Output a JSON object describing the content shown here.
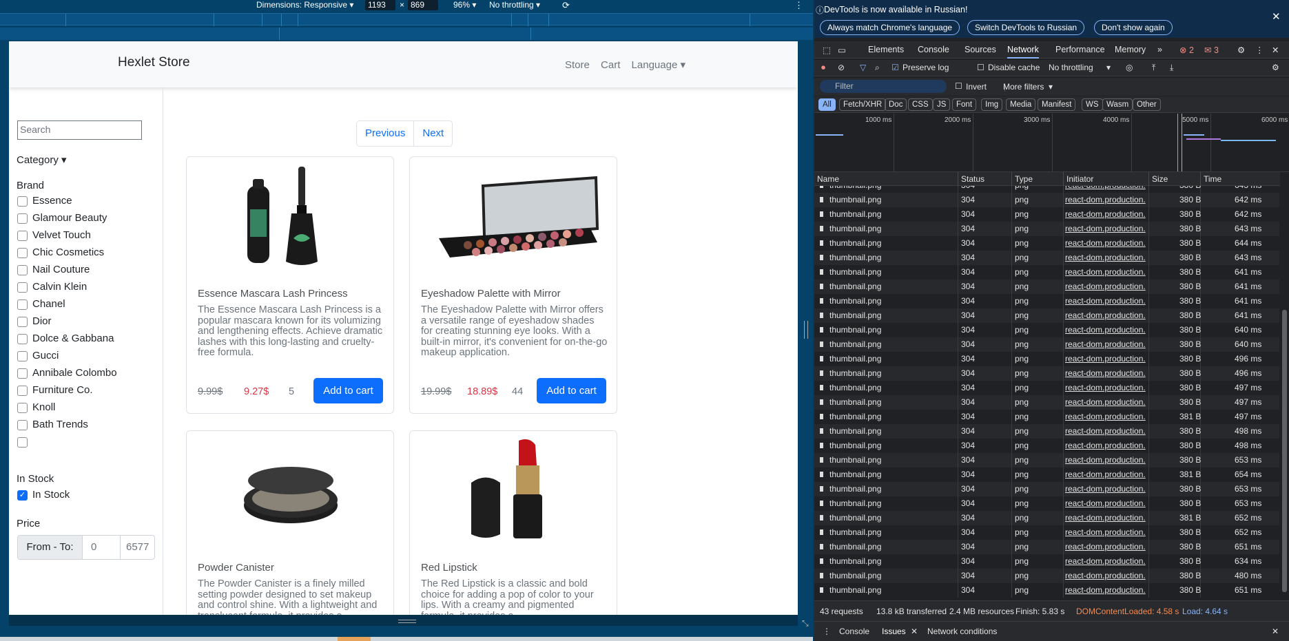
{
  "device_toolbar": {
    "dimensions_label": "Dimensions: Responsive ▾",
    "width": "1193",
    "times": "×",
    "height": "869",
    "zoom": "96% ▾",
    "throttling": "No throttling ▾"
  },
  "store": {
    "brand": "Hexlet Store",
    "nav": [
      "Store",
      "Cart",
      "Language ▾"
    ],
    "search_placeholder": "Search",
    "category_label": "Category ▾",
    "brand_heading": "Brand",
    "brands": [
      "Essence",
      "Glamour Beauty",
      "Velvet Touch",
      "Chic Cosmetics",
      "Nail Couture",
      "Calvin Klein",
      "Chanel",
      "Dior",
      "Dolce & Gabbana",
      "Gucci",
      "Annibale Colombo",
      "Furniture Co.",
      "Knoll",
      "Bath Trends",
      ""
    ],
    "instock_heading": "In Stock",
    "instock_label": "In Stock",
    "instock_checked": true,
    "price_heading": "Price",
    "price_from_to": "From - To:",
    "price_min": "0",
    "price_max": "6577",
    "pager_prev": "Previous",
    "pager_next": "Next",
    "products": [
      {
        "title": "Essence Mascara Lash Princess",
        "description": "The Essence Mascara Lash Princess is a popular mascara known for its volumizing and lengthening effects. Achieve dramatic lashes with this long-lasting and cruelty-free formula.",
        "old_price": "9.99$",
        "price": "9.27$",
        "stock": "5",
        "button": "Add to cart",
        "image": "mascara"
      },
      {
        "title": "Eyeshadow Palette with Mirror",
        "description": "The Eyeshadow Palette with Mirror offers a versatile range of eyeshadow shades for creating stunning eye looks. With a built-in mirror, it's convenient for on-the-go makeup application.",
        "old_price": "19.99$",
        "price": "18.89$",
        "stock": "44",
        "button": "Add to cart",
        "image": "palette"
      },
      {
        "title": "Powder Canister",
        "description": "The Powder Canister is a finely milled setting powder designed to set makeup and control shine. With a lightweight and translucent formula, it provides a",
        "image": "powder"
      },
      {
        "title": "Red Lipstick",
        "description": "The Red Lipstick is a classic and bold choice for adding a pop of color to your lips. With a creamy and pigmented formula, it provides a",
        "image": "lipstick"
      }
    ]
  },
  "devtools": {
    "info_message": "DevTools is now available in Russian!",
    "info_buttons": [
      "Always match Chrome's language",
      "Switch DevTools to Russian",
      "Don't show again"
    ],
    "tabs": [
      "Elements",
      "Console",
      "Sources",
      "Network",
      "Performance",
      "Memory"
    ],
    "selected_tab": "Network",
    "errors": "2",
    "warnings": "3",
    "preserve_log": "Preserve log",
    "disable_cache": "Disable cache",
    "throttling": "No throttling",
    "filter_placeholder": "Filter",
    "invert": "Invert",
    "more_filters": "More filters",
    "type_filters": [
      "All",
      "Fetch/XHR",
      "Doc",
      "CSS",
      "JS",
      "Font",
      "Img",
      "Media",
      "Manifest",
      "WS",
      "Wasm",
      "Other"
    ],
    "timeline_labels": [
      "1000 ms",
      "2000 ms",
      "3000 ms",
      "4000 ms",
      "5000 ms",
      "6000 ms"
    ],
    "columns": [
      "Name",
      "Status",
      "Type",
      "Initiator",
      "Size",
      "Time"
    ],
    "rows": [
      {
        "name": "thumbnail.png",
        "status": "304",
        "type": "png",
        "initiator": "react-dom.production.",
        "size": "380 B",
        "time": "643 ms"
      },
      {
        "name": "thumbnail.png",
        "status": "304",
        "type": "png",
        "initiator": "react-dom.production.",
        "size": "380 B",
        "time": "642 ms"
      },
      {
        "name": "thumbnail.png",
        "status": "304",
        "type": "png",
        "initiator": "react-dom.production.",
        "size": "380 B",
        "time": "642 ms"
      },
      {
        "name": "thumbnail.png",
        "status": "304",
        "type": "png",
        "initiator": "react-dom.production.",
        "size": "380 B",
        "time": "643 ms"
      },
      {
        "name": "thumbnail.png",
        "status": "304",
        "type": "png",
        "initiator": "react-dom.production.",
        "size": "380 B",
        "time": "644 ms"
      },
      {
        "name": "thumbnail.png",
        "status": "304",
        "type": "png",
        "initiator": "react-dom.production.",
        "size": "380 B",
        "time": "643 ms"
      },
      {
        "name": "thumbnail.png",
        "status": "304",
        "type": "png",
        "initiator": "react-dom.production.",
        "size": "380 B",
        "time": "641 ms"
      },
      {
        "name": "thumbnail.png",
        "status": "304",
        "type": "png",
        "initiator": "react-dom.production.",
        "size": "380 B",
        "time": "641 ms"
      },
      {
        "name": "thumbnail.png",
        "status": "304",
        "type": "png",
        "initiator": "react-dom.production.",
        "size": "380 B",
        "time": "641 ms"
      },
      {
        "name": "thumbnail.png",
        "status": "304",
        "type": "png",
        "initiator": "react-dom.production.",
        "size": "380 B",
        "time": "641 ms"
      },
      {
        "name": "thumbnail.png",
        "status": "304",
        "type": "png",
        "initiator": "react-dom.production.",
        "size": "380 B",
        "time": "640 ms"
      },
      {
        "name": "thumbnail.png",
        "status": "304",
        "type": "png",
        "initiator": "react-dom.production.",
        "size": "380 B",
        "time": "640 ms"
      },
      {
        "name": "thumbnail.png",
        "status": "304",
        "type": "png",
        "initiator": "react-dom.production.",
        "size": "380 B",
        "time": "496 ms"
      },
      {
        "name": "thumbnail.png",
        "status": "304",
        "type": "png",
        "initiator": "react-dom.production.",
        "size": "380 B",
        "time": "496 ms"
      },
      {
        "name": "thumbnail.png",
        "status": "304",
        "type": "png",
        "initiator": "react-dom.production.",
        "size": "380 B",
        "time": "497 ms"
      },
      {
        "name": "thumbnail.png",
        "status": "304",
        "type": "png",
        "initiator": "react-dom.production.",
        "size": "380 B",
        "time": "497 ms"
      },
      {
        "name": "thumbnail.png",
        "status": "304",
        "type": "png",
        "initiator": "react-dom.production.",
        "size": "381 B",
        "time": "497 ms"
      },
      {
        "name": "thumbnail.png",
        "status": "304",
        "type": "png",
        "initiator": "react-dom.production.",
        "size": "380 B",
        "time": "498 ms"
      },
      {
        "name": "thumbnail.png",
        "status": "304",
        "type": "png",
        "initiator": "react-dom.production.",
        "size": "380 B",
        "time": "498 ms"
      },
      {
        "name": "thumbnail.png",
        "status": "304",
        "type": "png",
        "initiator": "react-dom.production.",
        "size": "380 B",
        "time": "653 ms"
      },
      {
        "name": "thumbnail.png",
        "status": "304",
        "type": "png",
        "initiator": "react-dom.production.",
        "size": "381 B",
        "time": "654 ms"
      },
      {
        "name": "thumbnail.png",
        "status": "304",
        "type": "png",
        "initiator": "react-dom.production.",
        "size": "380 B",
        "time": "653 ms"
      },
      {
        "name": "thumbnail.png",
        "status": "304",
        "type": "png",
        "initiator": "react-dom.production.",
        "size": "380 B",
        "time": "653 ms"
      },
      {
        "name": "thumbnail.png",
        "status": "304",
        "type": "png",
        "initiator": "react-dom.production.",
        "size": "381 B",
        "time": "652 ms"
      },
      {
        "name": "thumbnail.png",
        "status": "304",
        "type": "png",
        "initiator": "react-dom.production.",
        "size": "380 B",
        "time": "652 ms"
      },
      {
        "name": "thumbnail.png",
        "status": "304",
        "type": "png",
        "initiator": "react-dom.production.",
        "size": "380 B",
        "time": "651 ms"
      },
      {
        "name": "thumbnail.png",
        "status": "304",
        "type": "png",
        "initiator": "react-dom.production.",
        "size": "380 B",
        "time": "634 ms"
      },
      {
        "name": "thumbnail.png",
        "status": "304",
        "type": "png",
        "initiator": "react-dom.production.",
        "size": "380 B",
        "time": "480 ms"
      },
      {
        "name": "thumbnail.png",
        "status": "304",
        "type": "png",
        "initiator": "react-dom.production.",
        "size": "380 B",
        "time": "651 ms"
      }
    ],
    "summary": {
      "requests": "43 requests",
      "transferred": "13.8 kB transferred",
      "resources": "2.4 MB resources",
      "finish": "Finish: 5.83 s",
      "dcl": "DOMContentLoaded: 4.58 s",
      "load": "Load: 4.64 s"
    },
    "drawer_tabs": [
      "Console",
      "Issues",
      "Network conditions"
    ],
    "colors": {
      "dcl": "#f28b54",
      "load": "#8ab4f8",
      "accent": "#8ab4f8"
    }
  }
}
